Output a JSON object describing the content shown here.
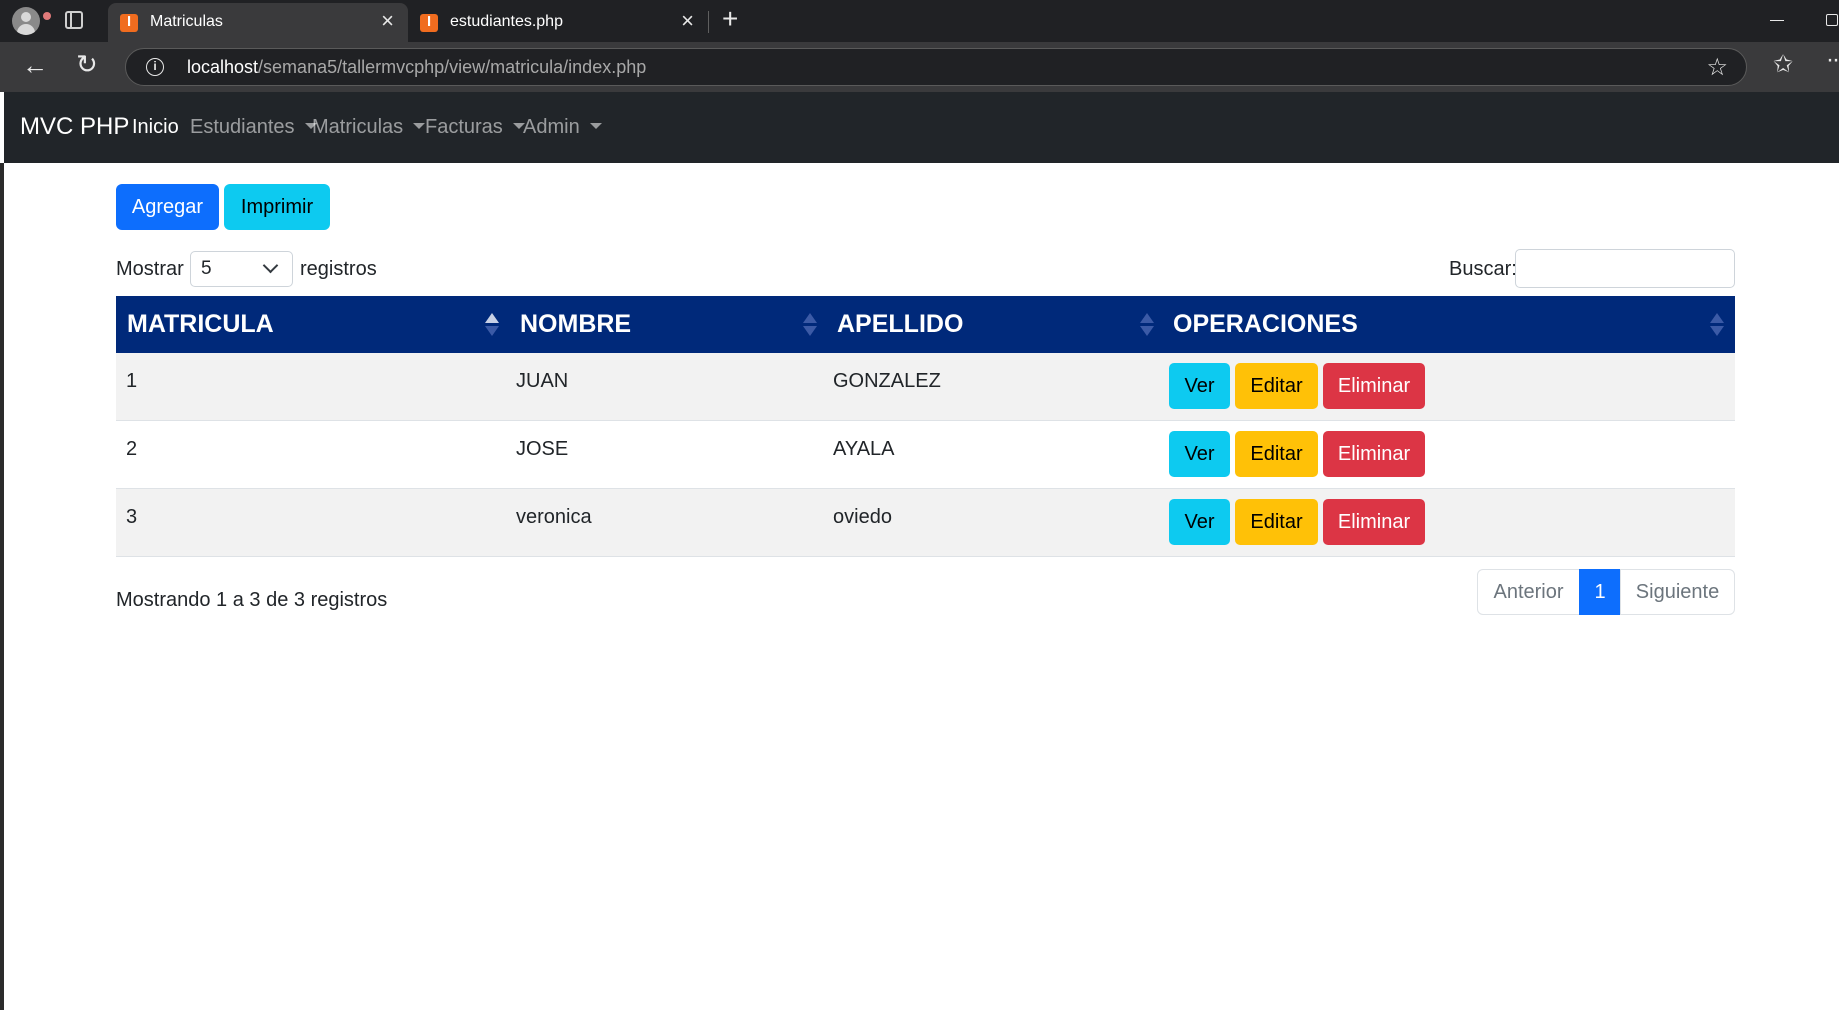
{
  "browser": {
    "tabs": [
      {
        "title": "Matriculas",
        "active": true
      },
      {
        "title": "estudiantes.php",
        "active": false
      }
    ],
    "url": {
      "host": "localhost",
      "path": "/semana5/tallermvcphp/view/matricula/index.php"
    }
  },
  "navbar": {
    "brand": "MVC PHP",
    "links": [
      {
        "label": "Inicio",
        "dropdown": false
      },
      {
        "label": "Estudiantes",
        "dropdown": true
      },
      {
        "label": "Matriculas",
        "dropdown": true
      },
      {
        "label": "Facturas",
        "dropdown": true
      },
      {
        "label": "Admin",
        "dropdown": true
      }
    ]
  },
  "actions": {
    "add_label": "Agregar",
    "print_label": "Imprimir"
  },
  "length_control": {
    "prefix": "Mostrar",
    "value": "5",
    "suffix": "registros"
  },
  "search": {
    "label": "Buscar:",
    "value": ""
  },
  "table": {
    "columns": [
      "MATRICULA",
      "NOMBRE",
      "APELLIDO",
      "OPERACIONES"
    ],
    "rows": [
      {
        "matricula": "1",
        "nombre": "JUAN",
        "apellido": "GONZALEZ"
      },
      {
        "matricula": "2",
        "nombre": "JOSE",
        "apellido": "AYALA"
      },
      {
        "matricula": "3",
        "nombre": "veronica",
        "apellido": "oviedo"
      }
    ],
    "row_actions": {
      "view": "Ver",
      "edit": "Editar",
      "delete": "Eliminar"
    }
  },
  "info": "Mostrando 1 a 3 de 3 registros",
  "pagination": {
    "prev": "Anterior",
    "current": "1",
    "next": "Siguiente"
  },
  "colors": {
    "primary": "#0d6efd",
    "info": "#0dcaf0",
    "warning": "#ffc107",
    "danger": "#dc3545",
    "table_header": "#00297a",
    "navbar": "#212529"
  }
}
